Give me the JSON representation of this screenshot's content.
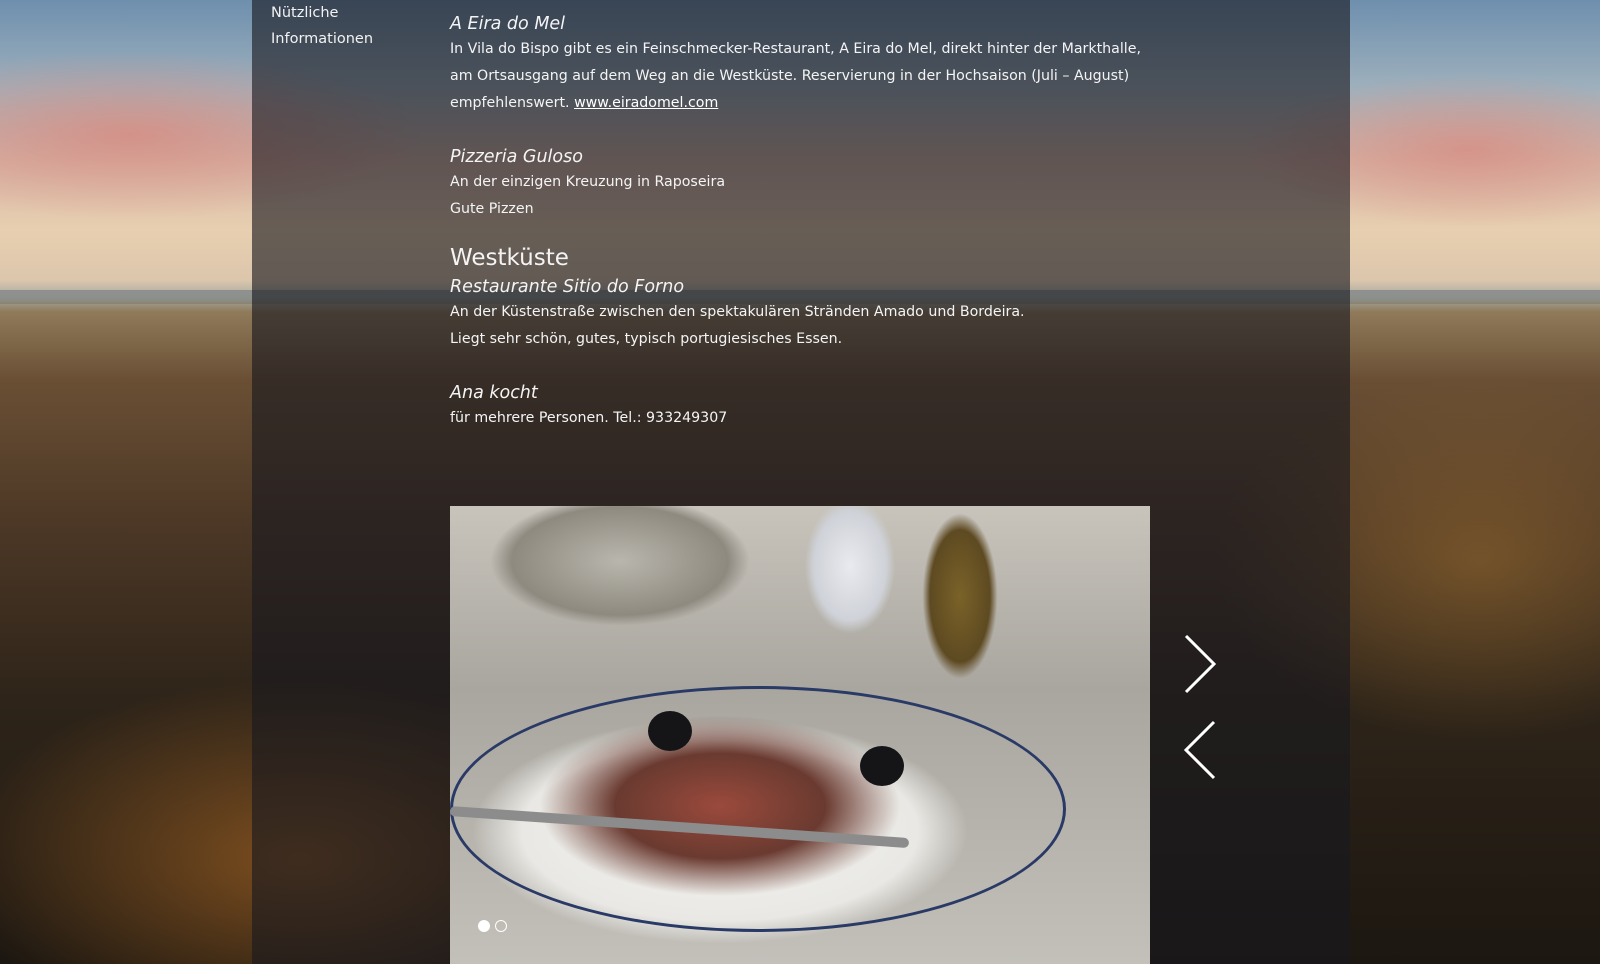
{
  "nav": {
    "useful_info": "Nützliche Informationen"
  },
  "entries": [
    {
      "title": "A Eira do Mel",
      "lines": [
        "In Vila do Bispo gibt es ein Feinschmecker-Restaurant, A Eira do Mel, direkt hinter der Markthalle,",
        "am Ortsausgang auf dem Weg an die Westküste. Reservierung in der Hochsaison (Juli – August)"
      ],
      "last_line_prefix": "empfehlenswert. ",
      "link": "www.eiradomel.com"
    },
    {
      "title": "Pizzeria Guloso",
      "lines": [
        "An der einzigen Kreuzung in Raposeira",
        "Gute Pizzen"
      ]
    }
  ],
  "section_westkueste": "Westküste",
  "west_entries": [
    {
      "title": "Restaurante Sitio do Forno",
      "lines": [
        "An der Küstenstraße zwischen den spektakulären Stränden Amado und Bordeira.",
        "Liegt sehr schön, gutes, typisch portugiesisches Essen."
      ]
    },
    {
      "title": "Ana kocht",
      "lines": [
        "für mehrere Personen. Tel.: 933249307"
      ]
    }
  ],
  "slider": {
    "slide_count": 2,
    "active_slide": 1,
    "next_icon": "chevron-right-icon",
    "prev_icon": "chevron-left-icon"
  }
}
